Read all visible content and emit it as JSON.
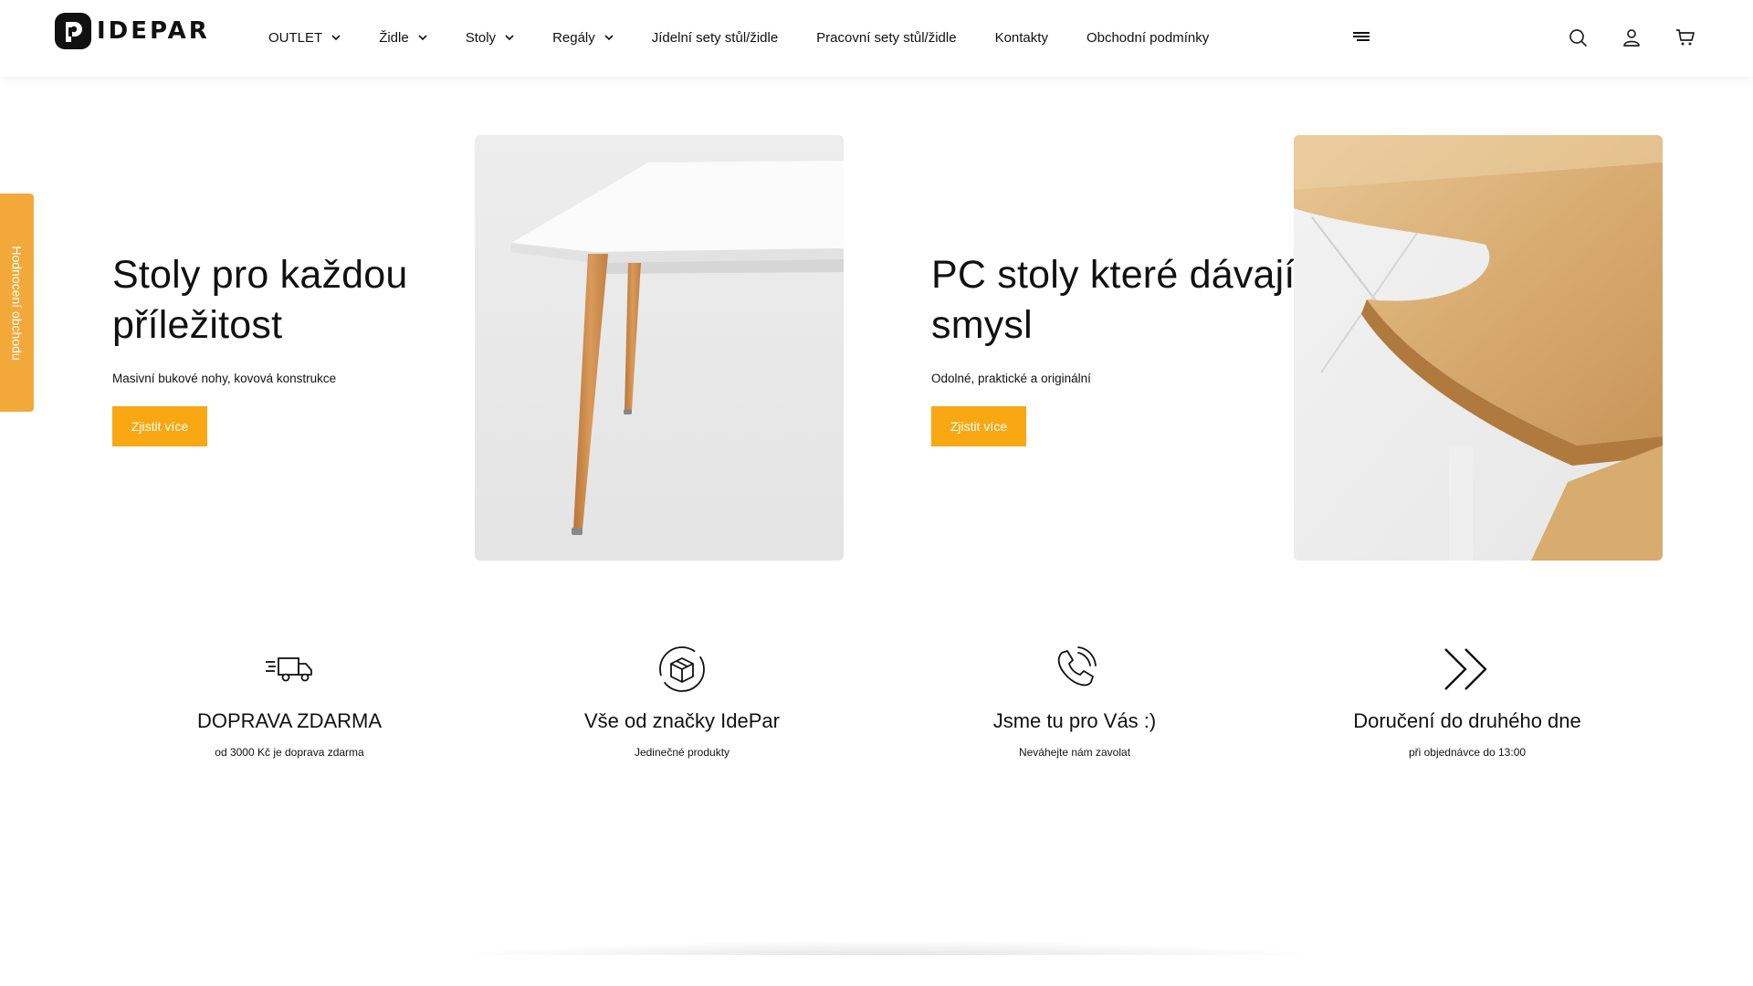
{
  "brand": {
    "name": "IDEPAR",
    "accent": "#f7a812",
    "side_tab_color": "#f3a93a"
  },
  "nav": {
    "items": [
      {
        "label": "OUTLET",
        "has_dropdown": true
      },
      {
        "label": "Židle",
        "has_dropdown": true
      },
      {
        "label": "Stoly",
        "has_dropdown": true
      },
      {
        "label": "Regály",
        "has_dropdown": true
      },
      {
        "label": "Jídelní sety stůl/židle",
        "has_dropdown": false
      },
      {
        "label": "Pracovní sety stůl/židle",
        "has_dropdown": false
      },
      {
        "label": "Kontakty",
        "has_dropdown": false
      },
      {
        "label": "Obchodní podmínky",
        "has_dropdown": false
      }
    ],
    "icons": [
      "menu-icon",
      "search-icon",
      "user-icon",
      "cart-icon"
    ]
  },
  "side_tab": {
    "label": "Hodnocení obchodu"
  },
  "hero": [
    {
      "title_line1": "Stoly pro každou",
      "title_line2": "příležitost",
      "subtitle": "Masivní bukové nohy, kovová konstrukce",
      "button": "Zjistit více"
    },
    {
      "title_line1": "PC stoly které dávají",
      "title_line2": "smysl",
      "subtitle": "Odolné, praktické a originální",
      "button": "Zjistit více"
    }
  ],
  "features": [
    {
      "icon": "truck-icon",
      "title": "DOPRAVA ZDARMA",
      "subtitle": "od 3000 Kč je doprava zdarma"
    },
    {
      "icon": "box-icon",
      "title": "Vše od značky IdePar",
      "subtitle": "Jedinečné produkty"
    },
    {
      "icon": "phone-icon",
      "title": "Jsme tu pro Vás :)",
      "subtitle": "Neváhejte nám zavolat"
    },
    {
      "icon": "double-chevron-icon",
      "title": "Doručení do druhého dne",
      "subtitle": "při objednávce do 13:00"
    }
  ]
}
